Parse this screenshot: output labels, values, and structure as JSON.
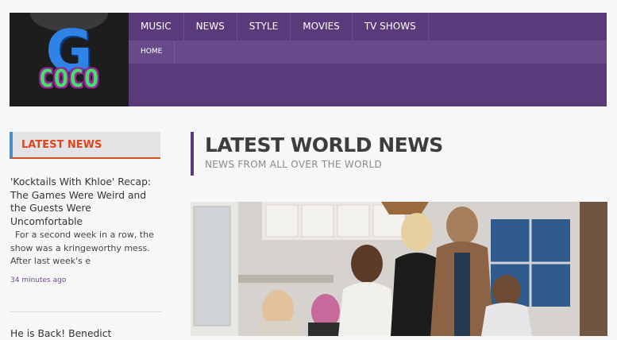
{
  "logo": {
    "letter": "G",
    "word": "COCO"
  },
  "nav": {
    "main": [
      "MUSIC",
      "NEWS",
      "STYLE",
      "MOVIES",
      "TV SHOWS"
    ],
    "sub": [
      "HOME"
    ]
  },
  "sidebar": {
    "heading": "LATEST NEWS",
    "articles": [
      {
        "title": "'Kocktails With Khloe' Recap: The Games Were Weird and the Guests Were Uncomfortable",
        "excerpt": "For a second week in a row, the show was a kringeworthy mess. After last week's e",
        "time": "34 minutes ago"
      },
      {
        "title": "He is Back! Benedict"
      }
    ]
  },
  "main": {
    "title": "LATEST WORLD NEWS",
    "subtitle": "NEWS FROM ALL OVER THE WORLD"
  },
  "colors": {
    "brand": "#5a3a7a",
    "accent": "#e0461b",
    "sidebar_border": "#4a8ec9"
  }
}
